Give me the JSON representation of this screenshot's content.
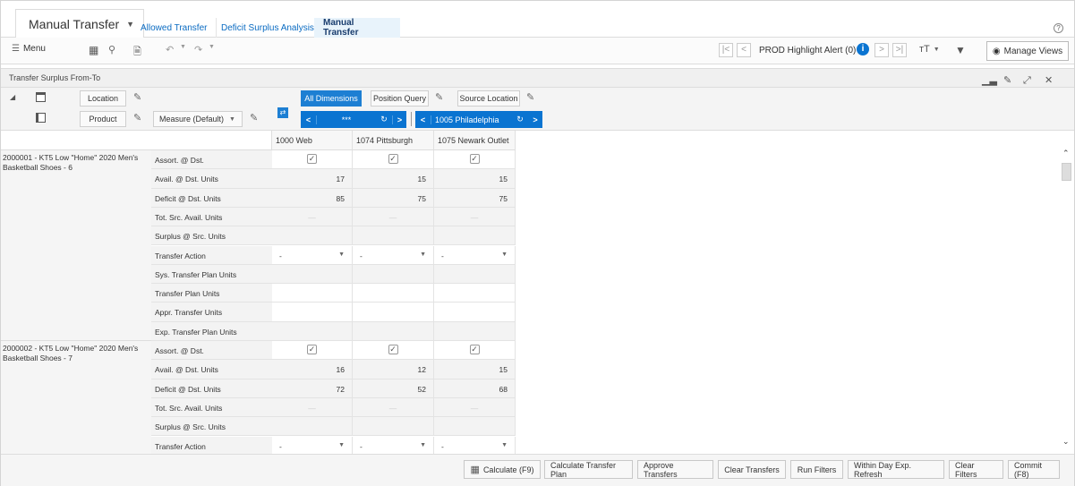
{
  "module": {
    "title": "Manual Transfer"
  },
  "tabs": [
    {
      "label": "Allowed Transfer"
    },
    {
      "label": "Deficit Surplus Analysis"
    },
    {
      "label": "Manual Transfer"
    }
  ],
  "toolbar": {
    "menu_label": "Menu",
    "alert_label": "PROD Highlight Alert (0)",
    "manage_views_label": "Manage Views"
  },
  "panel": {
    "title": "Transfer Surplus From-To"
  },
  "dimensions": {
    "location_label": "Location",
    "product_label": "Product",
    "measure_label": "Measure (Default)",
    "all_dimensions_label": "All Dimensions",
    "position_query_label": "Position Query",
    "source_location_label": "Source Location",
    "nav_ellipsis": "***",
    "source_location_value": "1005 Philadelphia"
  },
  "columns": [
    "1000 Web",
    "1074 Pittsburgh",
    "1075 Newark Outlet"
  ],
  "products": [
    {
      "label": "2000001 - KT5 Low \"Home\" 2020 Men's Basketball Shoes - 6"
    },
    {
      "label": "2000002 - KT5 Low \"Home\" 2020 Men's Basketball Shoes - 7"
    }
  ],
  "measures": [
    "Assort. @ Dst.",
    "Avail. @ Dst. Units",
    "Deficit @ Dst. Units",
    "Tot. Src. Avail. Units",
    "Surplus @ Src. Units",
    "Transfer Action",
    "Sys. Transfer Plan Units",
    "Transfer Plan Units",
    "Appr. Transfer Units",
    "Exp. Transfer Plan Units",
    "Assort. @ Dst.",
    "Avail. @ Dst. Units",
    "Deficit @ Dst. Units",
    "Tot. Src. Avail. Units",
    "Surplus @ Src. Units",
    "Transfer Action"
  ],
  "values": {
    "p1_avail": [
      "17",
      "15",
      "15"
    ],
    "p1_deficit": [
      "85",
      "75",
      "75"
    ],
    "p2_avail": [
      "16",
      "12",
      "15"
    ],
    "p2_deficit": [
      "72",
      "52",
      "68"
    ],
    "dash": "—",
    "action": "-"
  },
  "footer": {
    "calculate": "Calculate (F9)",
    "calc_plan": "Calculate Transfer Plan",
    "approve": "Approve Transfers",
    "clear_transfers": "Clear Transfers",
    "run_filters": "Run Filters",
    "within_day": "Within Day Exp. Refresh",
    "clear_filters": "Clear Filters",
    "commit": "Commit (F8)"
  }
}
